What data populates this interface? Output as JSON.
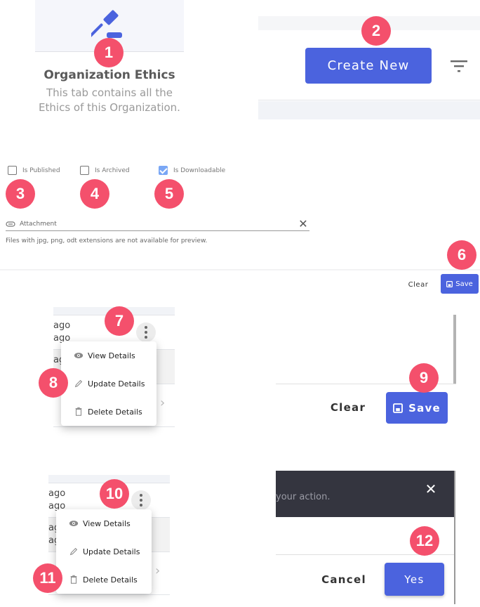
{
  "colors": {
    "primary": "#4b63de",
    "badge": "#f4506c",
    "checkbox_checked": "#7aa7f5",
    "dialog_header": "#34353f"
  },
  "badges": [
    "1",
    "2",
    "3",
    "4",
    "5",
    "6",
    "7",
    "8",
    "9",
    "10",
    "11",
    "12"
  ],
  "ethics": {
    "icon": "gavel-icon",
    "title": "Organization Ethics",
    "description": "This tab contains all the Ethics of this Organization."
  },
  "header": {
    "create_label": "Create New",
    "filter_icon": "filter-icon"
  },
  "form": {
    "checkboxes": [
      {
        "label": "Is Published",
        "checked": false
      },
      {
        "label": "Is Archived",
        "checked": false
      },
      {
        "label": "Is Downloadable",
        "checked": true
      }
    ],
    "attachment": {
      "placeholder": "Attachment",
      "hint": "Files with jpg, png, odt extensions are not available for preview."
    },
    "clear_label": "Clear",
    "save_label": "Save"
  },
  "table": {
    "rows": [
      {
        "line1": "ago",
        "line2": "ago"
      },
      {
        "line1": "ago",
        "line2": "ago"
      }
    ]
  },
  "menu": {
    "items": [
      {
        "label": "View Details",
        "icon": "eye-icon"
      },
      {
        "label": "Update Details",
        "icon": "pencil-icon"
      },
      {
        "label": "Delete Details",
        "icon": "trash-icon"
      }
    ]
  },
  "edit_footer": {
    "clear_label": "Clear",
    "save_label": "Save"
  },
  "dialog": {
    "message_fragment": "your action.",
    "cancel_label": "Cancel",
    "yes_label": "Yes"
  }
}
